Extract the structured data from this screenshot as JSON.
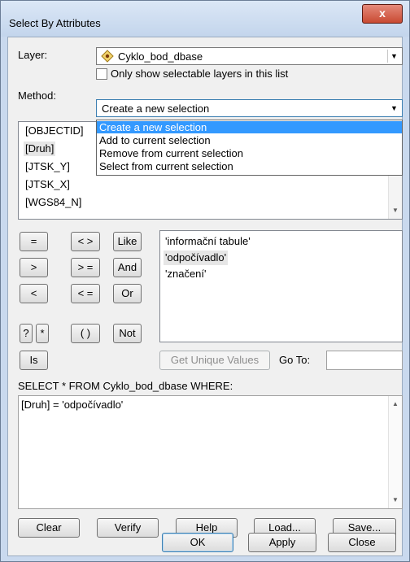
{
  "window": {
    "title": "Select By Attributes",
    "close_label": "x"
  },
  "layer": {
    "label": "Layer:",
    "value": "Cyklo_bod_dbase",
    "only_selectable_label": "Only show selectable layers in this list",
    "only_selectable_checked": false
  },
  "method": {
    "label": "Method:",
    "value": "Create a new selection",
    "options": [
      "Create a new selection",
      "Add to current selection",
      "Remove from current selection",
      "Select from current selection"
    ]
  },
  "fields": [
    "[OBJECTID]",
    "[Druh]",
    "[JTSK_Y]",
    "[JTSK_X]",
    "[WGS84_N]"
  ],
  "selected_field": "[Druh]",
  "operators": {
    "eq": "=",
    "ne": "< >",
    "like": "Like",
    "gt": ">",
    "ge": "> =",
    "and": "And",
    "lt": "<",
    "le": "< =",
    "or": "Or",
    "q": "?",
    "star": "*",
    "paren": "( )",
    "not": "Not",
    "is": "Is"
  },
  "values": [
    "'informační tabule'",
    "'odpočívadlo'",
    "'značení'"
  ],
  "selected_value": "'odpočívadlo'",
  "get_unique_values_label": "Get Unique Values",
  "goto_label": "Go To:",
  "goto_value": "",
  "sql_prefix": "SELECT * FROM Cyklo_bod_dbase WHERE:",
  "sql_expression": "[Druh] = 'odpočívadlo'",
  "buttons": {
    "clear": "Clear",
    "verify": "Verify",
    "help": "Help",
    "load": "Load...",
    "save": "Save...",
    "ok": "OK",
    "apply": "Apply",
    "close": "Close"
  }
}
